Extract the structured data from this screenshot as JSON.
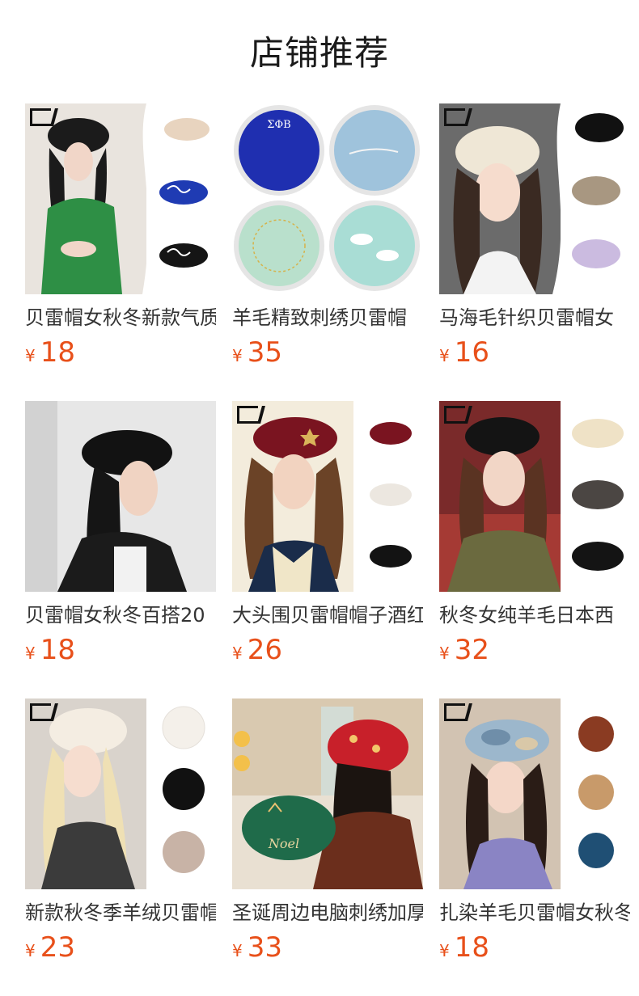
{
  "page": {
    "title": "店铺推荐"
  },
  "colors": {
    "price": "#e8501a",
    "title": "#1a1a1a",
    "name": "#333333"
  },
  "products": [
    {
      "name": "贝雷帽女秋冬新款气质",
      "currency": "¥",
      "price": "18",
      "image_icon": "product-photo-black-beret-green-cardigan",
      "swatch_labels": [
        "杏色",
        "宝蓝",
        "黑色"
      ]
    },
    {
      "name": "羊毛精致刺绣贝雷帽",
      "currency": "¥",
      "price": "35",
      "image_icon": "product-photo-embroidered-berets",
      "embroidery_text": "ΣΦΒ"
    },
    {
      "name": "马海毛针织贝雷帽女",
      "currency": "¥",
      "price": "16",
      "image_icon": "product-photo-mohair-beret",
      "swatch_labels": [
        "黑色",
        "咖啡",
        "香芋紫"
      ]
    },
    {
      "name": "贝雷帽女秋冬百搭20",
      "currency": "¥",
      "price": "18",
      "image_icon": "product-photo-black-beret-profile"
    },
    {
      "name": "大头围贝雷帽帽子酒红",
      "currency": "¥",
      "price": "26",
      "image_icon": "product-photo-wine-red-beret",
      "swatch_labels": [
        "酒红",
        "米色",
        "黑色"
      ]
    },
    {
      "name": "秋冬女纯羊毛日本西",
      "currency": "¥",
      "price": "32",
      "image_icon": "product-photo-wool-beret",
      "swatch_labels": [
        "米色",
        "灰色",
        "黑色"
      ]
    },
    {
      "name": "新款秋冬季羊绒贝雷帽",
      "currency": "¥",
      "price": "23",
      "image_icon": "product-photo-cashmere-beret",
      "swatch_labels": [
        "羊绒白色",
        "羊绒黑色",
        "羊绒卡其"
      ]
    },
    {
      "name": "圣诞周边电脑刺绣加厚",
      "currency": "¥",
      "price": "33",
      "image_icon": "product-photo-christmas-beret",
      "embroidery_text": "Noel"
    },
    {
      "name": "扎染羊毛贝雷帽女秋冬",
      "currency": "¥",
      "price": "18",
      "image_icon": "product-photo-tie-dye-beret",
      "swatch_labels": [
        "砖红",
        "驼色",
        "孔雀蓝"
      ]
    }
  ]
}
